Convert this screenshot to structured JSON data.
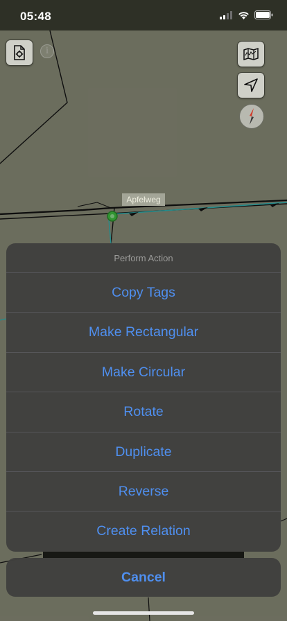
{
  "status_bar": {
    "time": "05:48"
  },
  "map": {
    "road_label": "Apfelweg",
    "icons": {
      "settings": "document-gear-icon",
      "info": "info-icon",
      "layers": "map-layers-icon",
      "locate": "location-arrow-icon",
      "compass": "compass-icon"
    },
    "info_glyph": "i"
  },
  "action_sheet": {
    "title": "Perform Action",
    "actions": [
      "Copy Tags",
      "Make Rectangular",
      "Make Circular",
      "Rotate",
      "Duplicate",
      "Reverse",
      "Create Relation"
    ],
    "cancel_label": "Cancel"
  },
  "colors": {
    "action_text": "#4f8fef",
    "sheet_background": "#40403e",
    "map_background": "#8a8c78",
    "selected_node": "#3fbf3f"
  }
}
